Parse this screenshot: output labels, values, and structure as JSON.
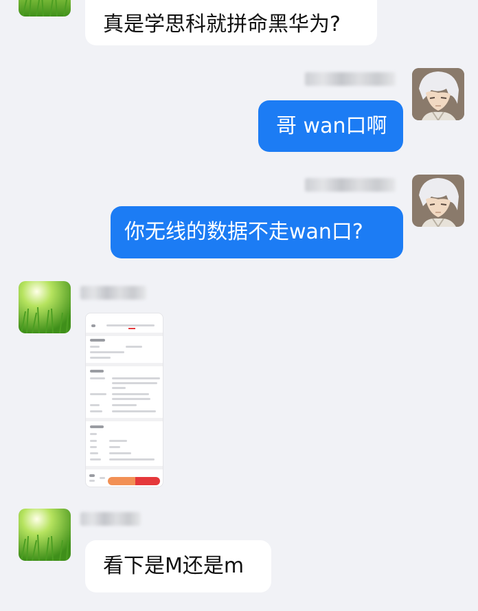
{
  "messages": [
    {
      "id": "m1",
      "side": "left",
      "text": "真是学思科就拼命黑华为?"
    },
    {
      "id": "m2",
      "side": "right",
      "text": "哥 wan口啊"
    },
    {
      "id": "m3",
      "side": "right",
      "text": "你无线的数据不走wan口?"
    },
    {
      "id": "m4",
      "side": "left",
      "type": "image"
    },
    {
      "id": "m5",
      "side": "left",
      "text": "看下是M还是m"
    }
  ],
  "avatars": {
    "contact": "grass-avatar",
    "self": "anime-character-avatar"
  },
  "colors": {
    "background": "#f1f2f6",
    "incoming_bubble": "#ffffff",
    "outgoing_bubble": "#1c7cf4",
    "outgoing_text": "#ffffff"
  }
}
